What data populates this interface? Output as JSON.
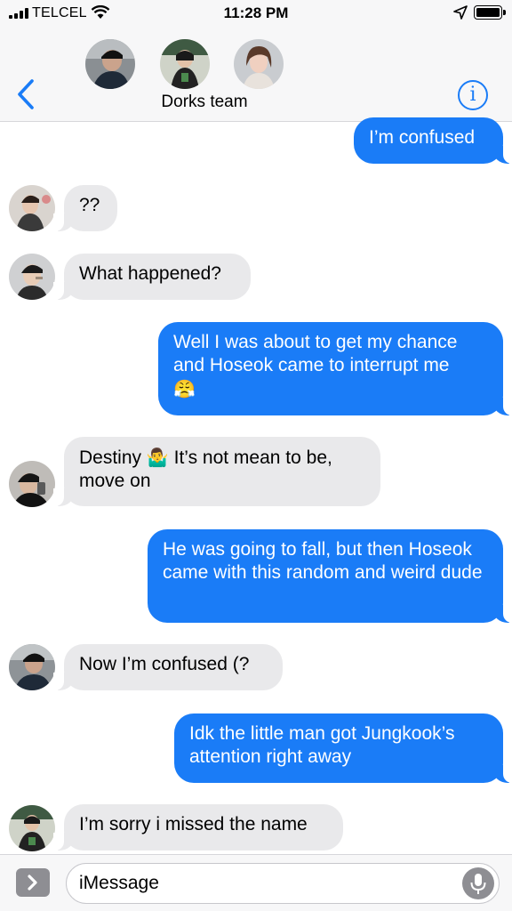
{
  "status_bar": {
    "carrier": "TELCEL",
    "time": "11:28 PM"
  },
  "header": {
    "group_name": "Dorks team",
    "info_label": "i"
  },
  "messages": [
    {
      "side": "sent",
      "text": "I’m confused"
    },
    {
      "side": "received",
      "text": "??"
    },
    {
      "side": "received",
      "text": "What happened?"
    },
    {
      "side": "sent",
      "text": "Well I was about to get my chance and Hoseok came to interrupt me",
      "emoji": "😤"
    },
    {
      "side": "received",
      "text_before": "Destiny",
      "emoji": "🤷‍♂️",
      "text_after": " It’s not mean to be, move on"
    },
    {
      "side": "sent",
      "text": "He was going to fall, but then Hoseok came with this random and weird dude"
    },
    {
      "side": "received",
      "text": "Now I’m confused (?"
    },
    {
      "side": "sent",
      "text": "Idk the little man got Jungkook’s attention right away"
    },
    {
      "side": "received",
      "text": "I’m sorry i missed the name"
    }
  ],
  "composer": {
    "placeholder": "iMessage"
  },
  "icons": [
    "signal-icon",
    "wifi-icon",
    "location-arrow-icon",
    "battery-icon",
    "back-chevron-icon",
    "info-icon",
    "app-drawer-chevron-icon",
    "microphone-icon"
  ],
  "colors": {
    "sent_bubble": "#1a7cf7",
    "received_bubble": "#e9e9eb",
    "accent": "#1a7cf7"
  }
}
